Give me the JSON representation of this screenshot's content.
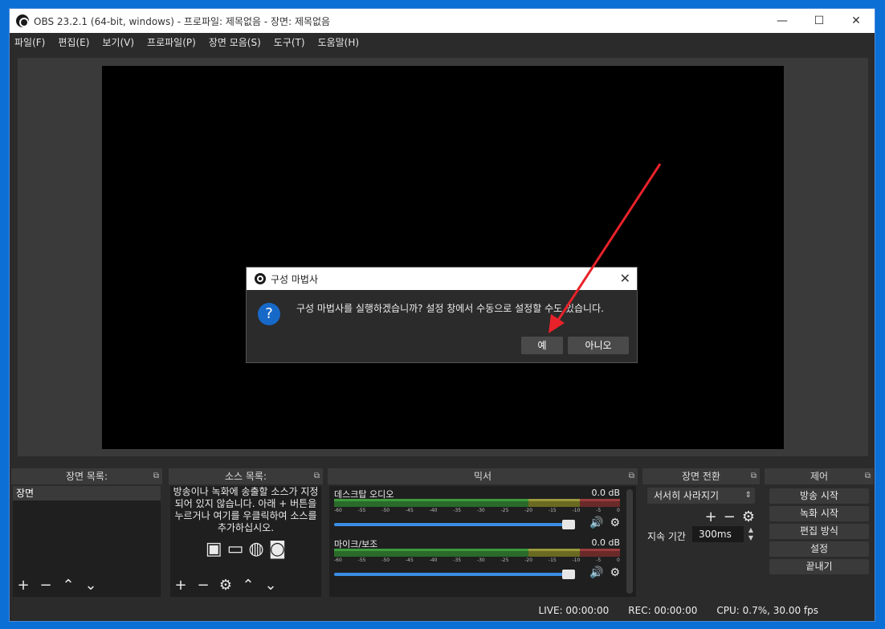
{
  "window": {
    "title": "OBS 23.2.1 (64-bit, windows) - 프로파일: 제목없음 - 장면: 제목없음",
    "controls": {
      "minimize": "—",
      "maximize": "☐",
      "close": "✕"
    }
  },
  "menu": [
    "파일(F)",
    "편집(E)",
    "보기(V)",
    "프로파일(P)",
    "장면 모음(S)",
    "도구(T)",
    "도움말(H)"
  ],
  "docks": {
    "scenes": {
      "title": "장면 목록:",
      "items": [
        "장면"
      ]
    },
    "sources": {
      "title": "소스 목록:",
      "message": "방송이나 녹화에 송출할 소스가 지정되어 있지 않습니다. 아래 + 버튼을 누르거나 여기를 우클릭하여 소스를 추가하십시오."
    },
    "mixer": {
      "title": "믹서",
      "channels": [
        {
          "name": "데스크탑 오디오",
          "db": "0.0 dB"
        },
        {
          "name": "마이크/보조",
          "db": "0.0 dB"
        }
      ],
      "ticks": [
        "-60",
        "-55",
        "-50",
        "-45",
        "-40",
        "-35",
        "-30",
        "-25",
        "-20",
        "-15",
        "-10",
        "-5",
        "0"
      ]
    },
    "transitions": {
      "title": "장면 전환",
      "selected": "서서히 사라지기",
      "duration_label": "지속 기간",
      "duration": "300ms"
    },
    "controls": {
      "title": "제어",
      "buttons": [
        "방송 시작",
        "녹화 시작",
        "편집 방식",
        "설정",
        "끝내기"
      ]
    }
  },
  "status": {
    "live": "LIVE: 00:00:00",
    "rec": "REC: 00:00:00",
    "cpu": "CPU: 0.7%, 30.00 fps"
  },
  "dialog": {
    "title": "구성 마법사",
    "message": "구성 마법사를 실행하겠습니까? 설정 창에서 수동으로 설정할 수도 있습니다.",
    "yes": "예",
    "no": "아니오",
    "close": "✕"
  },
  "colors": {
    "desktop": "#0b6fd6",
    "panel": "#2b2b2b",
    "accent": "#3a8ee6",
    "annotation_arrow": "#e8222a"
  }
}
